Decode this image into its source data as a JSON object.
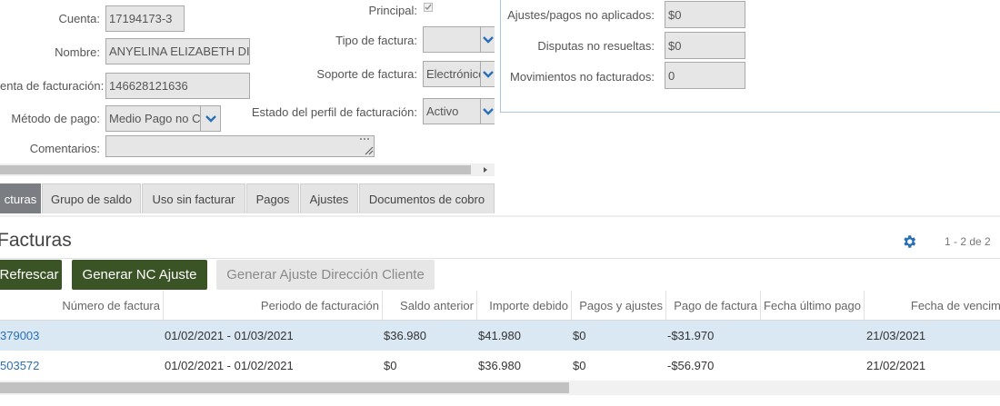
{
  "form": {
    "cuenta_label": "Cuenta:",
    "cuenta_value": "17194173-3",
    "nombre_label": "Nombre:",
    "nombre_value": "ANYELINA ELIZABETH DIA",
    "cuenta_facturacion_label": "enta de facturación:",
    "cuenta_facturacion_value": "146628121636",
    "metodo_pago_label": "Método de pago:",
    "metodo_pago_value": "Medio Pago no C",
    "comentarios_label": "Comentarios:",
    "comentarios_value": "",
    "principal_label": "Principal:",
    "tipo_factura_label": "Tipo de factura:",
    "tipo_factura_value": "",
    "soporte_factura_label": "Soporte de factura:",
    "soporte_factura_value": "Electrónico",
    "estado_perfil_label": "Estado del perfil de facturación:",
    "estado_perfil_value": "Activo"
  },
  "summary": {
    "ajustes_label": "Ajustes/pagos no aplicados:",
    "ajustes_value": "$0",
    "disputas_label": "Disputas no resueltas:",
    "disputas_value": "$0",
    "movimientos_label": "Movimientos no facturados:",
    "movimientos_value": "0"
  },
  "tabs": [
    "cturas",
    "Grupo de saldo",
    "Uso sin facturar",
    "Pagos",
    "Ajustes",
    "Documentos de cobro"
  ],
  "section": {
    "title": "Facturas",
    "pagination": "1 - 2 de 2"
  },
  "buttons": {
    "refresh": "Refrescar",
    "generar_nc": "Generar NC Ajuste",
    "generar_ajuste": "Generar Ajuste Dirección Cliente"
  },
  "table": {
    "headers": [
      "Número de factura",
      "Periodo de facturación",
      "Saldo anterior",
      "Importe debido",
      "Pagos y ajustes",
      "Pago de factura",
      "Fecha último pago",
      "Fecha de vencimie"
    ],
    "rows": [
      [
        "379003",
        "01/02/2021 - 01/03/2021",
        "$36.980",
        "$41.980",
        "$0",
        "-$31.970",
        "",
        "21/03/2021"
      ],
      [
        "503572",
        "01/02/2021 - 01/02/2021",
        "$0",
        "$36.980",
        "$0",
        "-$56.970",
        "",
        "21/02/2021"
      ]
    ]
  },
  "colors": {
    "button_dark": "#3a5426",
    "link": "#2a6fb5",
    "selected_row": "#d9e8f3",
    "tab_active": "#7a7d82"
  }
}
